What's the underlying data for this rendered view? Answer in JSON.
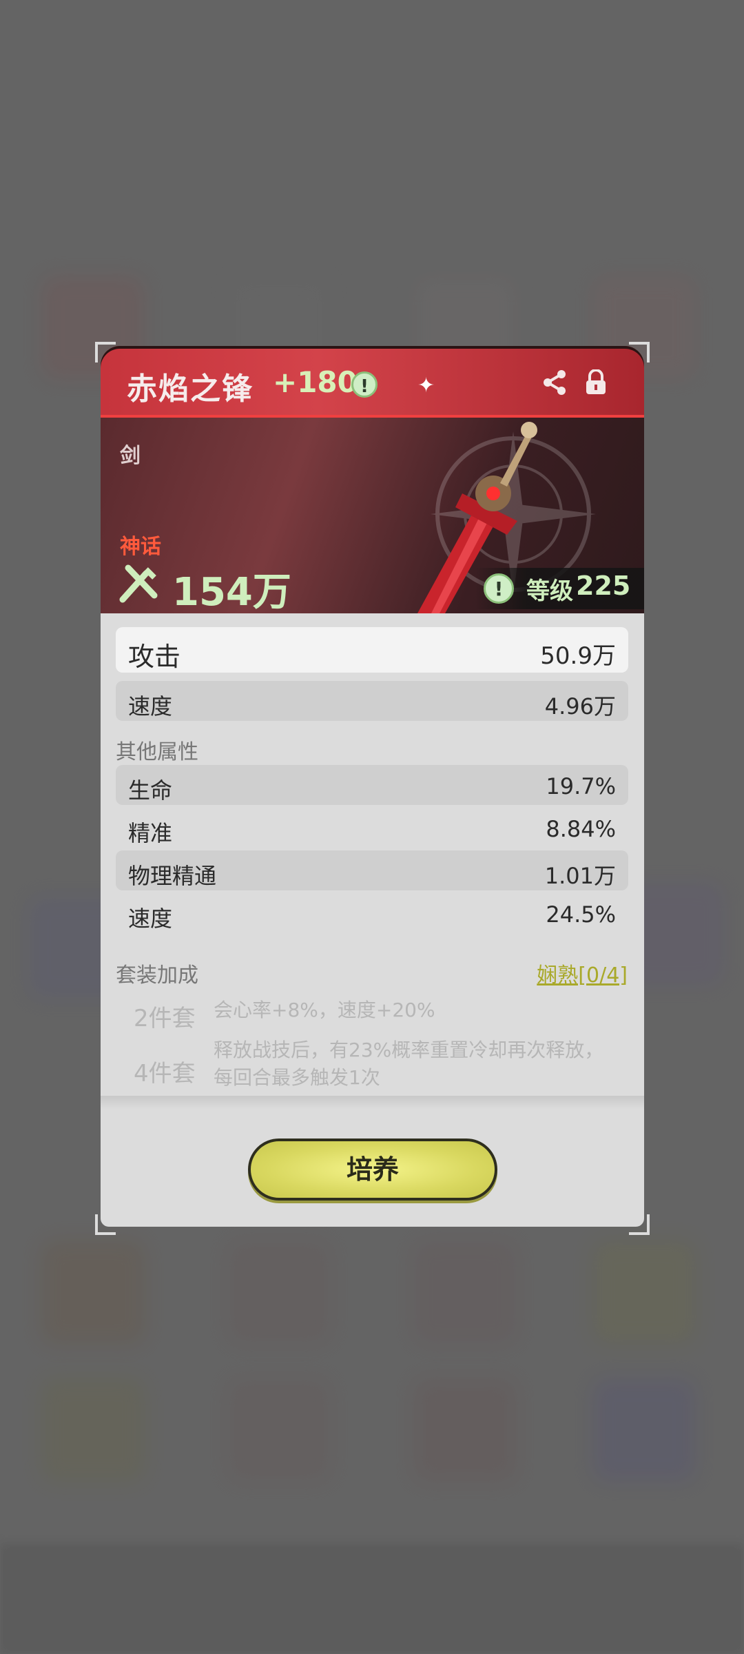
{
  "item": {
    "name": "赤焰之锋",
    "enhance": "+180",
    "type": "剑",
    "rarity": "神话",
    "power": "154万",
    "level_label": "等级",
    "level_value": "225"
  },
  "main_stats": [
    {
      "label": "攻击",
      "value": "50.9万"
    },
    {
      "label": "速度",
      "value": "4.96万"
    }
  ],
  "other_section": "其他属性",
  "other_stats": [
    {
      "label": "生命",
      "value": "19.7%"
    },
    {
      "label": "精准",
      "value": "8.84%"
    },
    {
      "label": "物理精通",
      "value": "1.01万"
    },
    {
      "label": "速度",
      "value": "24.5%"
    }
  ],
  "set_section": "套装加成",
  "mastery": "娴熟[0/4]",
  "sets": [
    {
      "name": "2件套",
      "desc": "会心率+8%，速度+20%"
    },
    {
      "name": "4件套",
      "desc": "释放战技后，有23%概率重置冷却再次释放，每回合最多触发1次"
    }
  ],
  "train_button": "培养",
  "icons": [
    "info-icon",
    "share-icon",
    "lock-icon",
    "power-icon",
    "sword-image"
  ],
  "colors": {
    "header": "#d3434a",
    "rarity": "#ff5a3c",
    "accent": "#cfeebd",
    "button": "#e6e574"
  }
}
